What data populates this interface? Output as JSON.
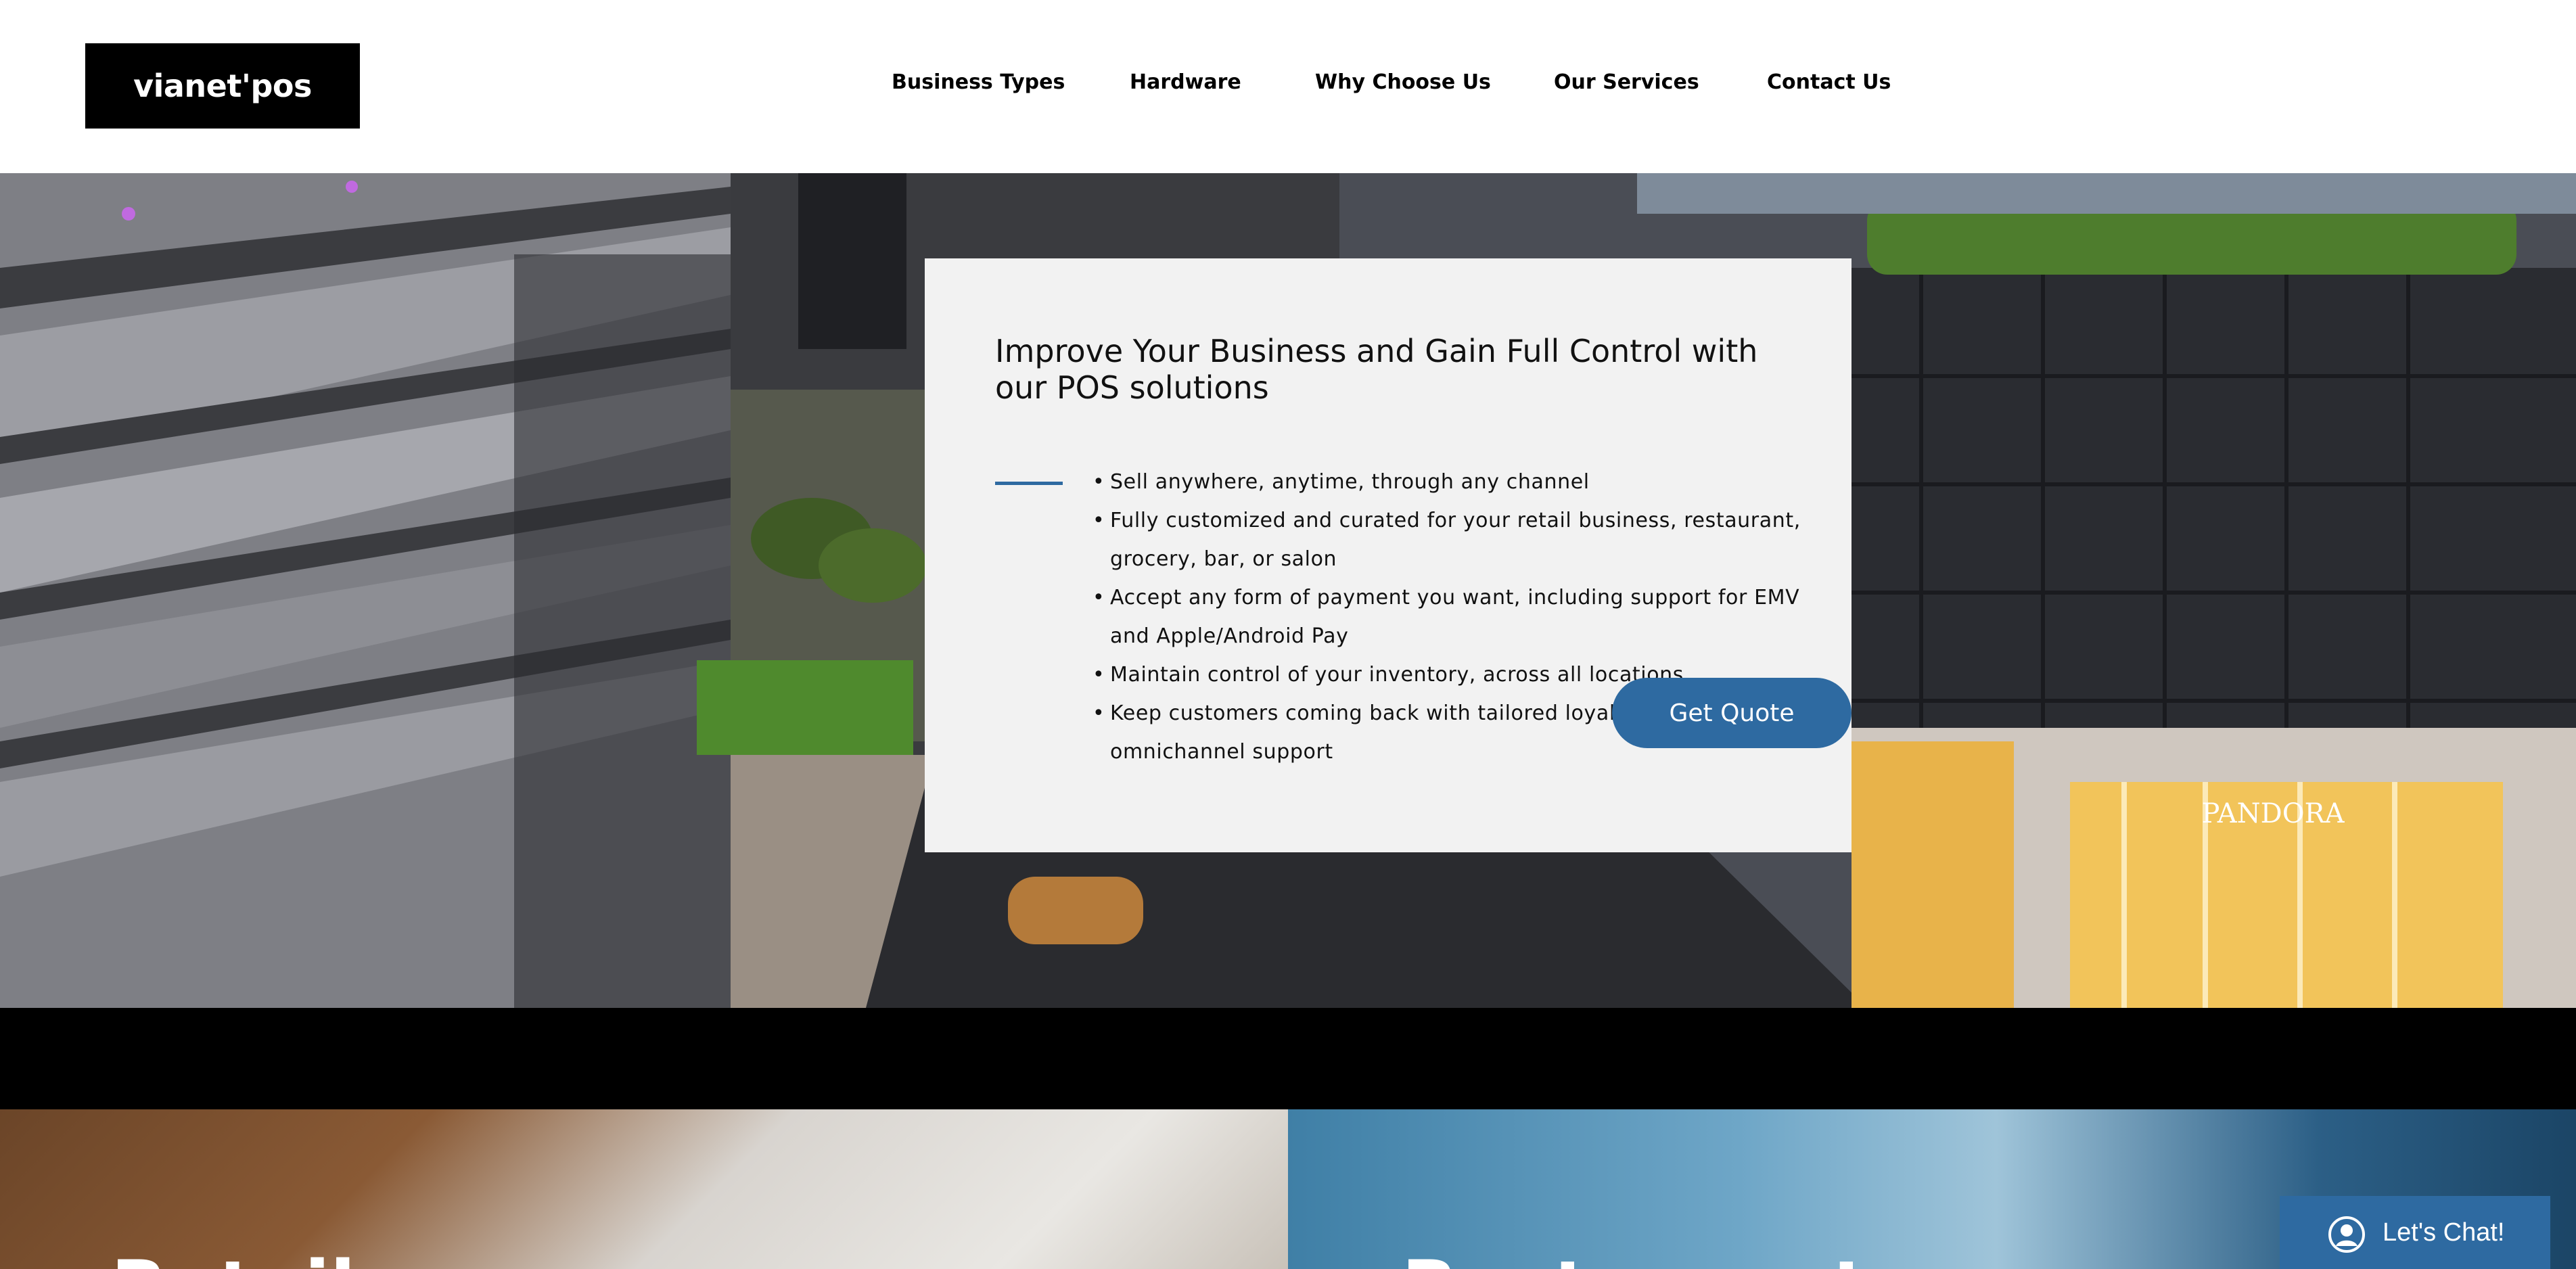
{
  "brand": {
    "logo_text": "vianet'pos"
  },
  "nav": {
    "items": [
      {
        "label": "Business Types"
      },
      {
        "label": "Hardware"
      },
      {
        "label": "Why Choose Us"
      },
      {
        "label": "Our Services"
      },
      {
        "label": "Contact Us"
      }
    ]
  },
  "hero": {
    "title": "Improve Your Business and Gain Full Control with our POS solutions",
    "bullets": [
      "Sell anywhere, anytime, through any channel",
      "Fully customized and curated for your retail business, restaurant, grocery, bar, or salon",
      "Accept any form of payment you want, including support for EMV and Apple/Android Pay",
      "Maintain control of your inventory, across all locations",
      "Keep customers coming back with tailored loyalty programs and omnichannel support"
    ],
    "cta_label": "Get Quote",
    "storefront_sign": "PANDORA"
  },
  "tiles": [
    {
      "label": "Retail"
    },
    {
      "label": "Restaurant"
    }
  ],
  "chat": {
    "label": "Let's Chat!"
  },
  "colors": {
    "accent": "#2e6aa1",
    "card": "#f2f2f2",
    "header": "#ffffff"
  }
}
